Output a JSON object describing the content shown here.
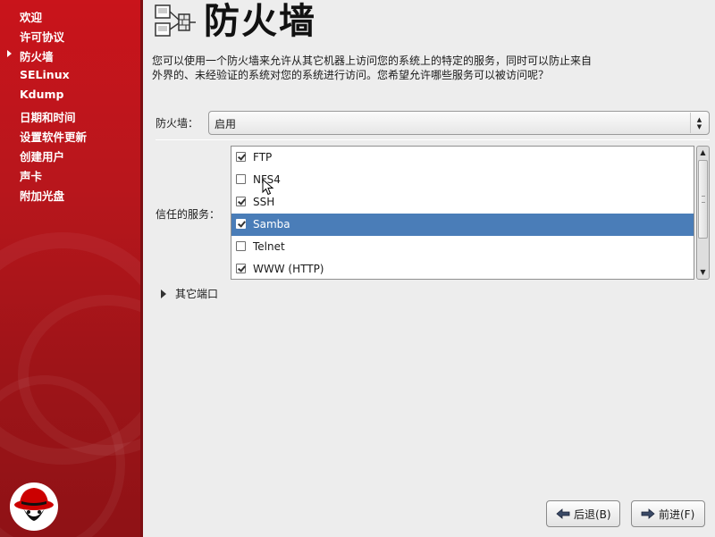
{
  "sidebar": {
    "steps": [
      {
        "label": "欢迎",
        "current": false
      },
      {
        "label": "许可协议",
        "current": false
      },
      {
        "label": "防火墙",
        "current": true
      },
      {
        "label": "SELinux",
        "current": false
      },
      {
        "label": "Kdump",
        "current": false
      },
      {
        "label": "日期和时间",
        "current": false
      },
      {
        "label": "设置软件更新",
        "current": false
      },
      {
        "label": "创建用户",
        "current": false
      },
      {
        "label": "声卡",
        "current": false
      },
      {
        "label": "附加光盘",
        "current": false
      }
    ],
    "logo_icon": "red-hat-logo"
  },
  "page": {
    "title": "防火墙",
    "header_icon": "firewall-icon",
    "description": "您可以使用一个防火墙来允许从其它机器上访问您的系统上的特定的服务，同时可以防止来自外界的、未经验证的系统对您的系统进行访问。您希望允许哪些服务可以被访问呢？"
  },
  "firewall": {
    "label": "防火墙：",
    "value": "启用"
  },
  "services": {
    "label": "信任的服务：",
    "items": [
      {
        "name": "FTP",
        "checked": true,
        "selected": false
      },
      {
        "name": "NFS4",
        "checked": false,
        "selected": false
      },
      {
        "name": "SSH",
        "checked": true,
        "selected": false
      },
      {
        "name": "Samba",
        "checked": true,
        "selected": true
      },
      {
        "name": "Telnet",
        "checked": false,
        "selected": false
      },
      {
        "name": "WWW (HTTP)",
        "checked": true,
        "selected": false
      }
    ]
  },
  "other_ports": {
    "label": "其它端口"
  },
  "nav": {
    "back_label": "后退(B)",
    "next_label": "前进(F)"
  },
  "colors": {
    "sidebar_red": "#b8161c",
    "selection_blue": "#4a7db8"
  }
}
